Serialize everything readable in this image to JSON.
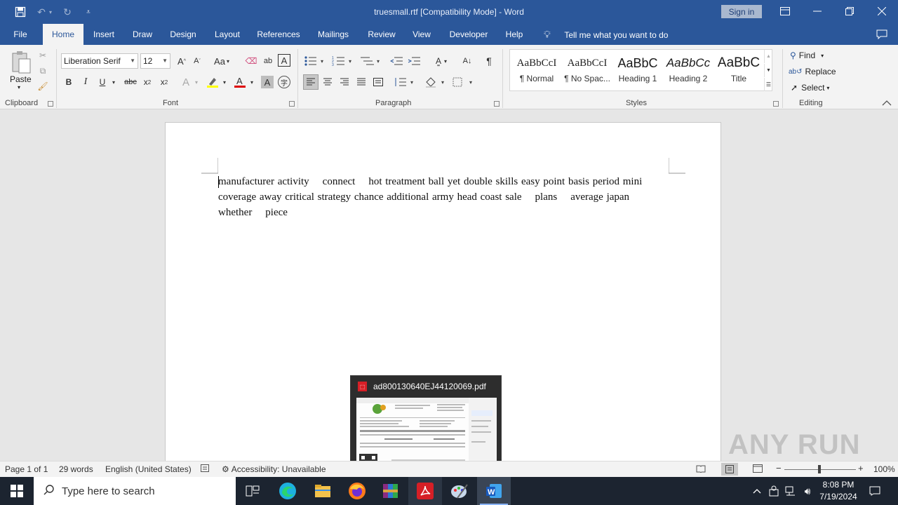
{
  "window": {
    "title": "truesmall.rtf [Compatibility Mode]  -  Word",
    "sign_in": "Sign in"
  },
  "tabs": [
    "File",
    "Home",
    "Insert",
    "Draw",
    "Design",
    "Layout",
    "References",
    "Mailings",
    "Review",
    "View",
    "Developer",
    "Help"
  ],
  "active_tab": "Home",
  "tell_me": "Tell me what you want to do",
  "ribbon": {
    "clipboard": {
      "paste": "Paste",
      "label": "Clipboard"
    },
    "font": {
      "name": "Liberation Serif",
      "size": "12",
      "case_label": "Aa",
      "label": "Font"
    },
    "paragraph": {
      "label": "Paragraph"
    },
    "styles": {
      "label": "Styles",
      "items": [
        {
          "sample": "AaBbCcI",
          "name": "¶ Normal"
        },
        {
          "sample": "AaBbCcI",
          "name": "¶ No Spac..."
        },
        {
          "sample": "AaBbC",
          "name": "Heading 1"
        },
        {
          "sample": "AaBbCc",
          "name": "Heading 2"
        },
        {
          "sample": "AaBbC",
          "name": "Title"
        }
      ]
    },
    "editing": {
      "find": "Find",
      "replace": "Replace",
      "select": "Select",
      "label": "Editing"
    }
  },
  "document": {
    "text": "manufacturer activity    connect    hot treatment ball yet double skills easy point basis period mini coverage away critical strategy chance additional army head coast sale    plans    average japan whether    piece"
  },
  "statusbar": {
    "page": "Page 1 of 1",
    "words": "29 words",
    "language": "English (United States)",
    "accessibility": "Accessibility: Unavailable",
    "zoom": "100%"
  },
  "taskbar": {
    "search_placeholder": "Type here to search",
    "time": "8:08 PM",
    "date": "7/19/2024"
  },
  "thumbnail": {
    "title": "ad800130640EJ44120069.pdf"
  },
  "watermark": "ANY RUN",
  "colors": {
    "word_blue": "#2b579a",
    "taskbar": "#1c2430",
    "ribbon_bg": "#f3f3f3"
  }
}
